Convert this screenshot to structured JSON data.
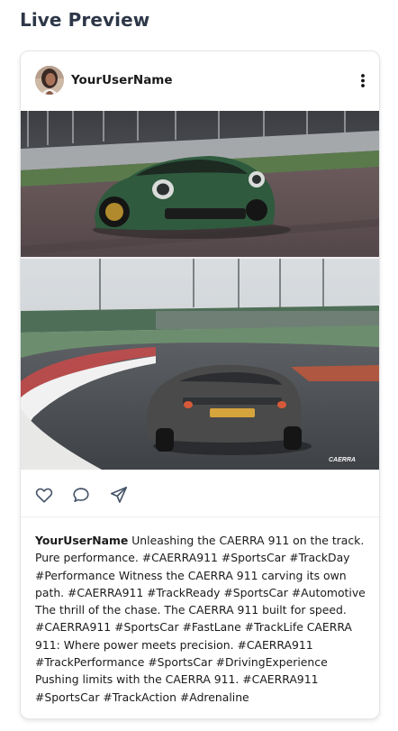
{
  "page": {
    "title": "Live Preview"
  },
  "post": {
    "username": "YourUserName",
    "caption_user": "YourUserName",
    "caption_text": "Unleashing the CAERRA 911 on the track. Pure performance. #CAERRA911 #SportsCar #TrackDay #Performance Witness the CAERRA 911 carving its own path. #CAERRA911 #TrackReady #SportsCar #Automotive The thrill of the chase. The CAERRA 911 built for speed. #CAERRA911 #SportsCar #FastLane #TrackLife CAERRA 911: Where power meets precision. #CAERRA911 #TrackPerformance #SportsCar #DrivingExperience Pushing limits with the CAERRA 911. #CAERRA911 #SportsCar #TrackAction #Adrenaline",
    "image_watermark": "CAERRA",
    "icons": {
      "avatar": "avatar-photo",
      "menu": "more-vertical-icon",
      "like": "heart-icon",
      "comment": "comment-icon",
      "share": "send-icon"
    }
  },
  "colors": {
    "title": "#2d3748",
    "icon": "#475569",
    "car_top": "#2f5a3e",
    "car_bottom": "#4a4a4a"
  }
}
